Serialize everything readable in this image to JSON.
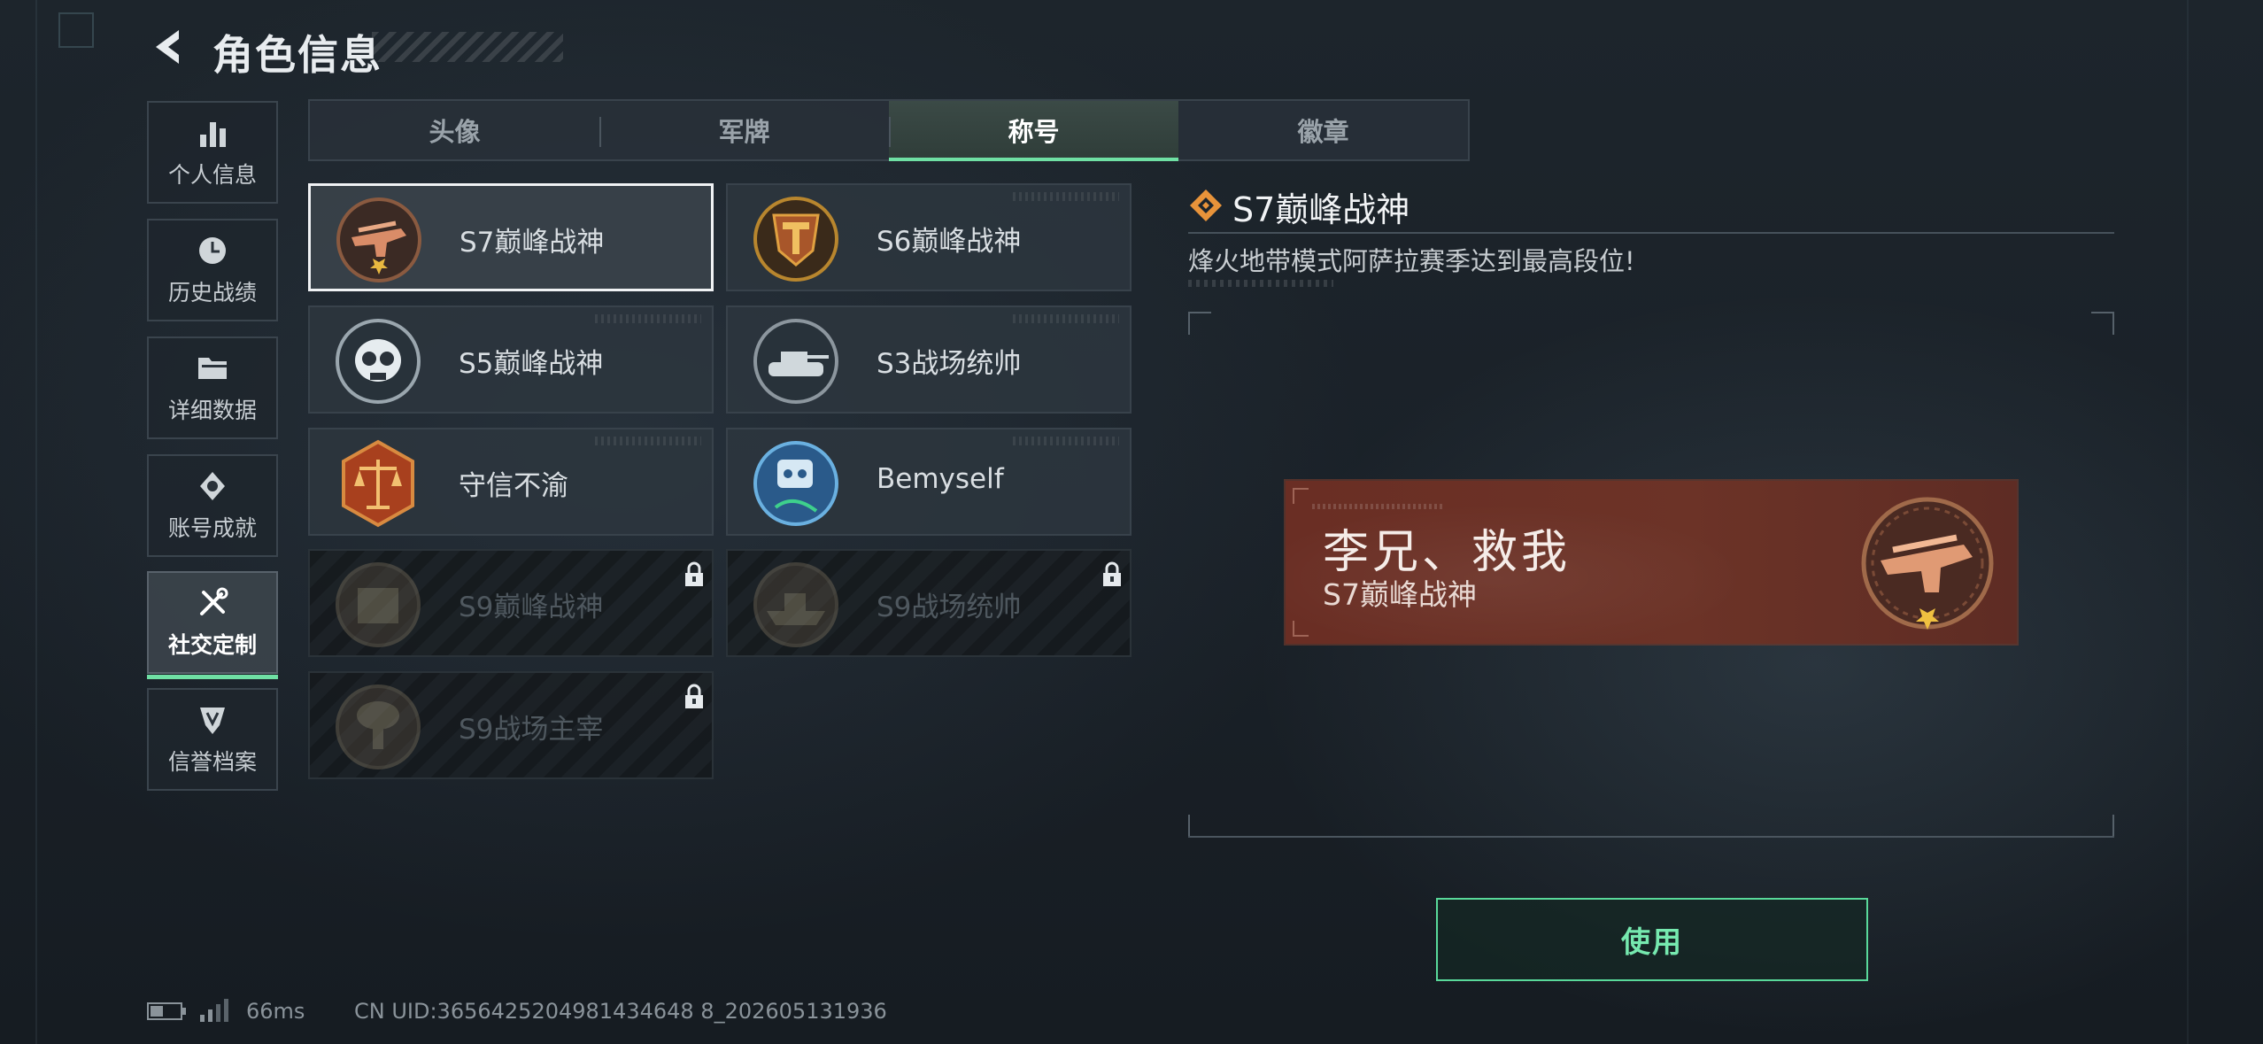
{
  "header": {
    "title": "角色信息",
    "back_icon": "back-arrow-icon"
  },
  "sidebar": {
    "items": [
      {
        "label": "个人信息",
        "icon": "bar-chart-icon",
        "active": false
      },
      {
        "label": "历史战绩",
        "icon": "clock-icon",
        "active": false
      },
      {
        "label": "详细数据",
        "icon": "folder-icon",
        "active": false
      },
      {
        "label": "账号成就",
        "icon": "medal-icon",
        "active": false
      },
      {
        "label": "社交定制",
        "icon": "tools-icon",
        "active": true
      },
      {
        "label": "信誉档案",
        "icon": "shield-emblem-icon",
        "active": false
      }
    ]
  },
  "tabs": [
    {
      "label": "头像",
      "active": false
    },
    {
      "label": "军牌",
      "active": false
    },
    {
      "label": "称号",
      "active": true
    },
    {
      "label": "徽章",
      "active": false
    }
  ],
  "titles": [
    {
      "name": "S7巅峰战神",
      "locked": false,
      "selected": true,
      "emblem": "rifle-emblem-icon"
    },
    {
      "name": "S6巅峰战神",
      "locked": false,
      "selected": false,
      "emblem": "t-shield-emblem-icon"
    },
    {
      "name": "S5巅峰战神",
      "locked": false,
      "selected": false,
      "emblem": "skull-emblem-icon"
    },
    {
      "name": "S3战场统帅",
      "locked": false,
      "selected": false,
      "emblem": "tank-emblem-icon"
    },
    {
      "name": "守信不渝",
      "locked": false,
      "selected": false,
      "emblem": "scales-emblem-icon"
    },
    {
      "name": "Bemyself",
      "locked": false,
      "selected": false,
      "emblem": "robot-emblem-icon"
    },
    {
      "name": "S9巅峰战神",
      "locked": true,
      "selected": false,
      "emblem": "fortress-emblem-icon"
    },
    {
      "name": "S9战场统帅",
      "locked": true,
      "selected": false,
      "emblem": "ship-emblem-icon"
    },
    {
      "name": "S9战场主宰",
      "locked": true,
      "selected": false,
      "emblem": "explosion-emblem-icon"
    }
  ],
  "detail": {
    "title": "S7巅峰战神",
    "description": "烽火地带模式阿萨拉赛季达到最高段位!",
    "preview": {
      "nickname": "李兄、救我",
      "title": "S7巅峰战神"
    },
    "use_button": "使用"
  },
  "status_bar": {
    "ping": "66ms",
    "uid": "CN UID:3656425204981434648 8_202605131936"
  },
  "colors": {
    "accent": "#6fe0a4",
    "banner": "#6a2e24",
    "emblem_bronze": "#c8845e"
  }
}
